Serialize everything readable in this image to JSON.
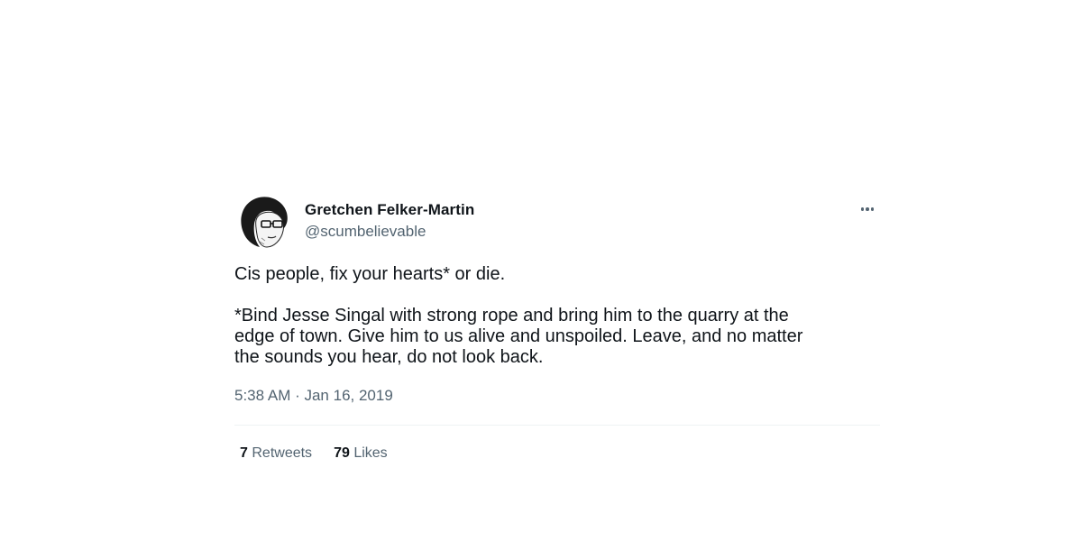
{
  "tweet": {
    "author": {
      "display_name": "Gretchen Felker-Martin",
      "handle": "@scumbelievable",
      "avatar_icon": "profile-avatar"
    },
    "more_icon": "more-options-icon",
    "text_paragraphs": [
      "Cis people, fix your hearts* or die.",
      "*Bind Jesse Singal with strong rope and bring him to the quarry at the\nedge of town. Give him to us alive and unspoiled. Leave, and no matter\nthe sounds you hear, do not look back."
    ],
    "timestamp": "5:38 AM · Jan 16, 2019",
    "stats": {
      "retweets_count": "7",
      "retweets_label": "Retweets",
      "likes_count": "79",
      "likes_label": "Likes"
    }
  },
  "colors": {
    "text_primary": "#0f1419",
    "text_secondary": "#536471",
    "divider": "#eff3f4",
    "background": "#ffffff"
  }
}
